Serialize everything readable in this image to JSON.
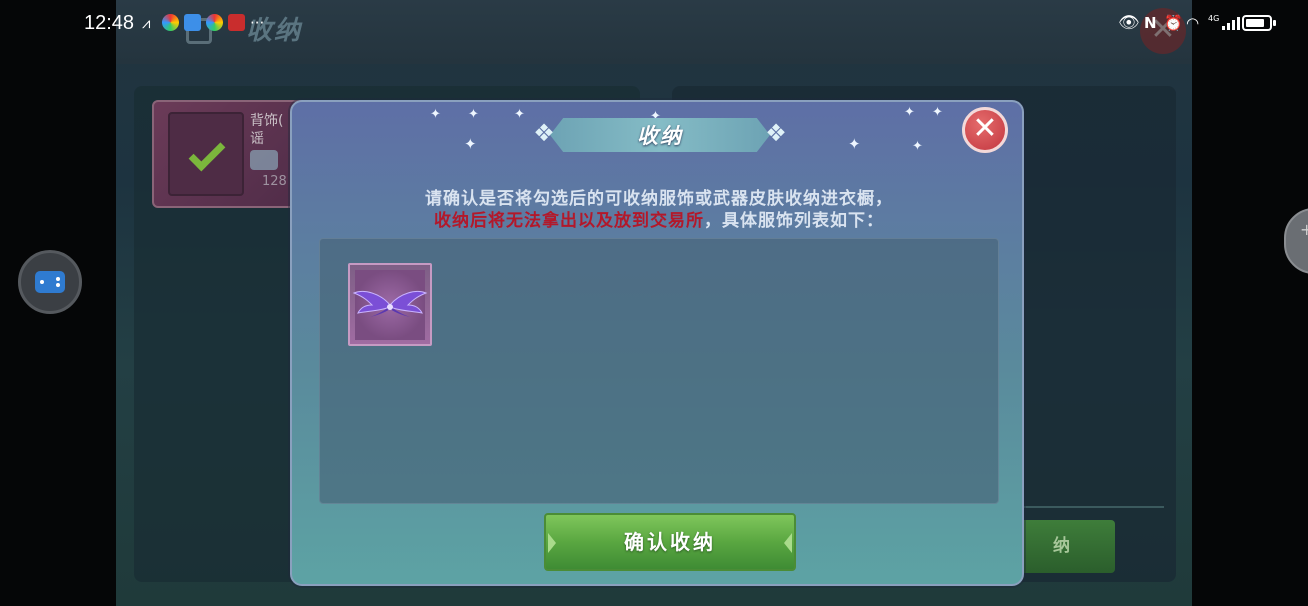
{
  "status_bar": {
    "time": "12:48",
    "overflow": "···",
    "network": "4G",
    "icons": [
      "eye-icon",
      "nfc-icon",
      "alarm-icon",
      "wifi-icon",
      "signal-icon",
      "battery-icon"
    ],
    "battery_level": 0.8
  },
  "background_screen": {
    "title": "收纳",
    "item": {
      "name_line1": "背饰(",
      "name_line2": "谣",
      "number": "128"
    },
    "button_partial_label": "纳"
  },
  "dialog": {
    "title": "收纳",
    "message_line1": "请确认是否将勾选后的可收纳服饰或武器皮肤收纳进衣橱，",
    "message_line2_warning": "收纳后将无法拿出以及放到交易所",
    "message_line2_rest": "，具体服饰列表如下：",
    "items": [
      {
        "icon": "purple-wings-icon",
        "rarity_color": "#a06ca2"
      }
    ],
    "confirm_button_label": "确认收纳"
  },
  "colors": {
    "warning_text": "#b3182a",
    "confirm_button": "#5aa741",
    "close_button": "#c2363f"
  }
}
